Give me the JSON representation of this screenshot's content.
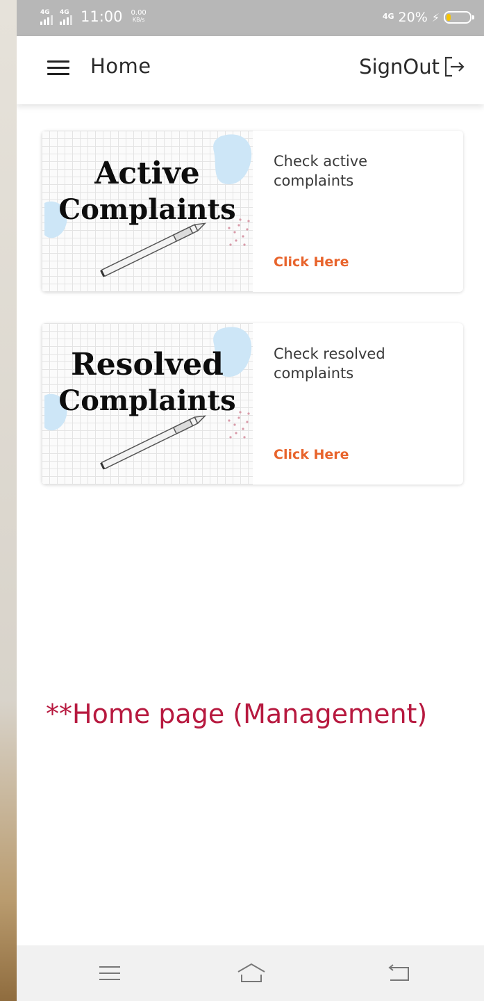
{
  "status_bar": {
    "sim1_label": "4G",
    "sim2_label": "4G",
    "time": "11:00",
    "speed_value": "0.00",
    "speed_unit": "KB/s",
    "network_label": "4G",
    "battery_text": "20%",
    "battery_level": 0.2,
    "battery_color": "#f6c400"
  },
  "app_bar": {
    "menu_icon": "hamburger-menu-icon",
    "title": "Home",
    "signout_label": "SignOut",
    "signout_icon": "logout-icon"
  },
  "cards": [
    {
      "image_title_line1": "Active",
      "image_title_line2": "Complaints",
      "description": "Check active complaints",
      "link_label": "Click Here"
    },
    {
      "image_title_line1": "Resolved",
      "image_title_line2": "Complaints",
      "description": "Check resolved complaints",
      "link_label": "Click Here"
    }
  ],
  "caption": "**Home page  (Management)",
  "nav_bar": {
    "recents_icon": "menu-lines-icon",
    "home_icon": "home-icon",
    "back_icon": "back-icon"
  },
  "colors": {
    "accent_link": "#e8642c",
    "caption": "#b7193f",
    "status_bar": "#b7b7b7"
  }
}
